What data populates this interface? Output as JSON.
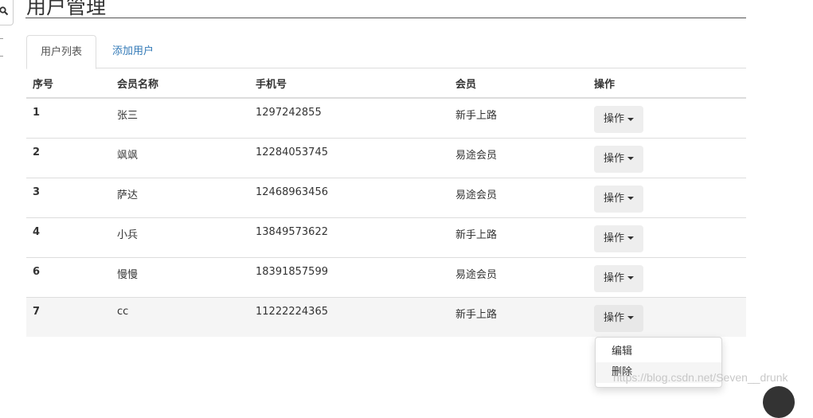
{
  "page": {
    "title": "用户管理"
  },
  "tabs": [
    {
      "label": "用户列表",
      "active": true
    },
    {
      "label": "添加用户",
      "active": false
    }
  ],
  "table": {
    "headers": [
      "序号",
      "会员名称",
      "手机号",
      "会员",
      "操作"
    ],
    "rows": [
      {
        "id": "1",
        "name": "张三",
        "phone": "1297242855",
        "level": "新手上路",
        "action": "操作"
      },
      {
        "id": "2",
        "name": "飒飒",
        "phone": "12284053745",
        "level": "易途会员",
        "action": "操作"
      },
      {
        "id": "3",
        "name": "萨达",
        "phone": "12468963456",
        "level": "易途会员",
        "action": "操作"
      },
      {
        "id": "4",
        "name": "小兵",
        "phone": "13849573622",
        "level": "新手上路",
        "action": "操作"
      },
      {
        "id": "6",
        "name": "慢慢",
        "phone": "18391857599",
        "level": "易途会员",
        "action": "操作"
      },
      {
        "id": "7",
        "name": "cc",
        "phone": "11222224365",
        "level": "新手上路",
        "action": "操作"
      }
    ]
  },
  "dropdown": {
    "items": [
      "编辑",
      "删除"
    ]
  },
  "watermark": "https://blog.csdn.net/Seven__drunk",
  "colors": {
    "link": "#337ab7",
    "border": "#dddddd",
    "button_bg": "#eeeeee",
    "row_highlight": "#f5f5f5"
  }
}
